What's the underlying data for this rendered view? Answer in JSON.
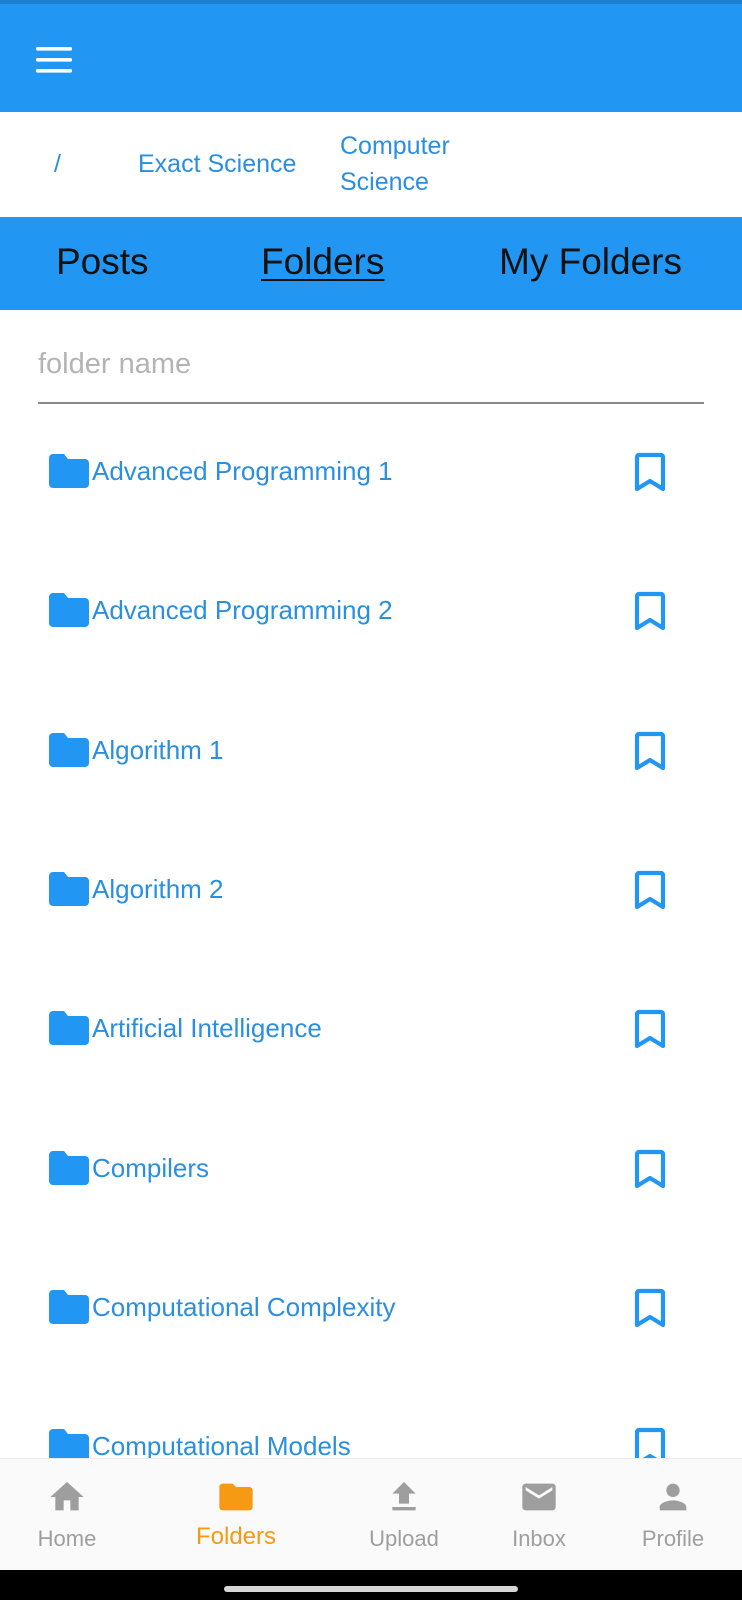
{
  "header": {
    "menu_icon": "hamburger-menu-icon",
    "bar_color": "#2196f3"
  },
  "breadcrumb": {
    "root": "/",
    "items": [
      "Exact Science",
      "Computer Science"
    ]
  },
  "tabs": [
    {
      "label": "Posts",
      "active": false
    },
    {
      "label": "Folders",
      "active": true
    },
    {
      "label": "My Folders",
      "active": false
    }
  ],
  "search": {
    "value": "",
    "placeholder": "folder name"
  },
  "folders": [
    {
      "name": "Advanced Programming 1",
      "icon": "folder-icon",
      "action_icon": "bookmark-icon"
    },
    {
      "name": "Advanced Programming 2",
      "icon": "folder-icon",
      "action_icon": "bookmark-icon"
    },
    {
      "name": "Algorithm 1",
      "icon": "folder-icon",
      "action_icon": "bookmark-icon"
    },
    {
      "name": "Algorithm 2",
      "icon": "folder-icon",
      "action_icon": "bookmark-icon"
    },
    {
      "name": "Artificial Intelligence",
      "icon": "folder-icon",
      "action_icon": "bookmark-icon"
    },
    {
      "name": "Compilers",
      "icon": "folder-icon",
      "action_icon": "bookmark-icon"
    },
    {
      "name": "Computational Complexity",
      "icon": "folder-icon",
      "action_icon": "bookmark-icon"
    },
    {
      "name": "Computational Models",
      "icon": "folder-icon",
      "action_icon": "bookmark-icon"
    }
  ],
  "bottom_nav": {
    "items": [
      {
        "label": "Home",
        "icon": "home-icon",
        "active": false
      },
      {
        "label": "Folders",
        "icon": "folder-icon",
        "active": true
      },
      {
        "label": "Upload",
        "icon": "upload-icon",
        "active": false
      },
      {
        "label": "Inbox",
        "icon": "mail-icon",
        "active": false
      },
      {
        "label": "Profile",
        "icon": "person-icon",
        "active": false
      }
    ]
  },
  "colors": {
    "accent": "#2196f3",
    "link": "#2a8fe0",
    "active_nav": "#f59a12",
    "inactive_nav": "#9e9e9e"
  }
}
